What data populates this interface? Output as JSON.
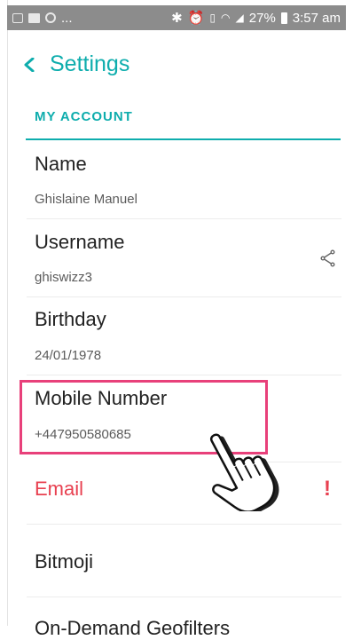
{
  "status_bar": {
    "icons": [
      "screenshot-icon",
      "gallery-icon",
      "whatsapp-icon",
      "bluetooth-icon",
      "alarm-icon",
      "vibrate-icon",
      "wifi-icon",
      "signal-icon",
      "battery-icon"
    ],
    "ellipsis": "...",
    "battery": "27%",
    "time": "3:57 am"
  },
  "header": {
    "back_icon": "chevron-left-icon",
    "title": "Settings"
  },
  "section": {
    "title": "MY ACCOUNT"
  },
  "rows": [
    {
      "label": "Name",
      "value": "Ghislaine Manuel"
    },
    {
      "label": "Username",
      "value": "ghiswizz3",
      "icon": "share-icon"
    },
    {
      "label": "Birthday",
      "value": "24/01/1978"
    },
    {
      "label": "Mobile Number",
      "value": "+447950580685",
      "highlighted": true
    },
    {
      "label": "Email",
      "alert": "!"
    },
    {
      "label": "Bitmoji"
    },
    {
      "label": "On-Demand Geofilters"
    }
  ],
  "colors": {
    "accent": "#0eadad",
    "alert": "#e84050",
    "highlight_border": "#e8407a",
    "status_bar": "#8c8c8c"
  },
  "overlay": {
    "pointer": "hand-pointer-icon"
  }
}
